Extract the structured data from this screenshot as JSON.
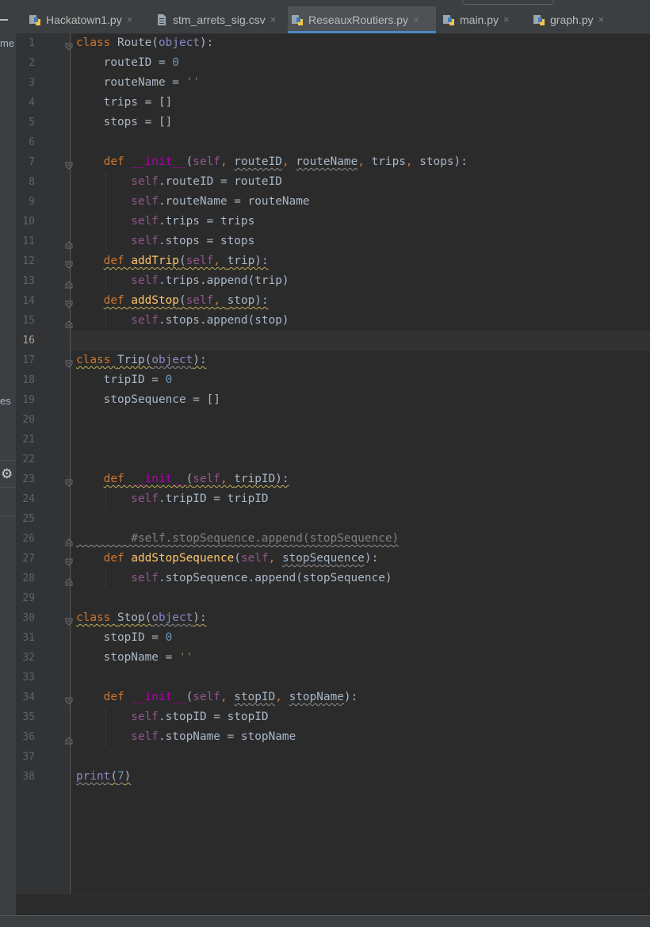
{
  "left_panel": {
    "clip_text_1": "me",
    "clip_text_2": "es"
  },
  "tabs": [
    {
      "label": "Hackatown1.py",
      "icon": "python-file-icon"
    },
    {
      "label": "stm_arrets_sig.csv",
      "icon": "text-file-icon"
    },
    {
      "label": "ReseauxRoutiers.py",
      "icon": "python-file-icon",
      "active": true
    },
    {
      "label": "main.py",
      "icon": "python-file-icon"
    },
    {
      "label": "graph.py",
      "icon": "python-file-icon"
    }
  ],
  "close_glyph": "×",
  "current_line": 16,
  "lines": [
    [
      [
        "k",
        "class "
      ],
      [
        "p",
        "Route("
      ],
      [
        "bi",
        "object"
      ],
      [
        "p",
        "):"
      ]
    ],
    [
      [
        "p",
        "    routeID = "
      ],
      [
        "n",
        "0"
      ]
    ],
    [
      [
        "p",
        "    routeName = "
      ],
      [
        "s",
        "''"
      ]
    ],
    [
      [
        "p",
        "    trips = []"
      ]
    ],
    [
      [
        "p",
        "    stops = []"
      ]
    ],
    [],
    [
      [
        "k",
        "    def "
      ],
      [
        "mg",
        "__init__"
      ],
      [
        "p",
        "("
      ],
      [
        "slf",
        "self"
      ],
      [
        "k",
        ", "
      ],
      [
        "wv",
        "routeID"
      ],
      [
        "k",
        ", "
      ],
      [
        "wv",
        "routeName"
      ],
      [
        "k",
        ", "
      ],
      [
        "p",
        "trips"
      ],
      [
        "k",
        ", "
      ],
      [
        "p",
        "stops):"
      ]
    ],
    [
      [
        "slf",
        "        self"
      ],
      [
        "p",
        ".routeID = routeID"
      ]
    ],
    [
      [
        "slf",
        "        self"
      ],
      [
        "p",
        ".routeName = routeName"
      ]
    ],
    [
      [
        "slf",
        "        self"
      ],
      [
        "p",
        ".trips = trips"
      ]
    ],
    [
      [
        "slf",
        "        self"
      ],
      [
        "p",
        ".stops = stops"
      ]
    ],
    [
      [
        "k",
        "    "
      ],
      [
        "wvk",
        "def "
      ],
      [
        "wvf",
        "addTrip"
      ],
      [
        "wvp",
        "("
      ],
      [
        "wvs",
        "self"
      ],
      [
        "wvk",
        ", "
      ],
      [
        "wvp",
        "trip):"
      ]
    ],
    [
      [
        "slf",
        "        self"
      ],
      [
        "p",
        ".trips.append(trip)"
      ]
    ],
    [
      [
        "k",
        "    "
      ],
      [
        "wvk",
        "def "
      ],
      [
        "wvf",
        "addStop"
      ],
      [
        "wvp",
        "("
      ],
      [
        "wvs",
        "self"
      ],
      [
        "wvk",
        ", "
      ],
      [
        "wvp",
        "stop):"
      ]
    ],
    [
      [
        "slf",
        "        self"
      ],
      [
        "p",
        ".stops.append(stop)"
      ]
    ],
    [],
    [
      [
        "wvk",
        "class "
      ],
      [
        "wvp",
        "Trip("
      ],
      [
        "wvb",
        "object"
      ],
      [
        "wvp",
        "):"
      ]
    ],
    [
      [
        "p",
        "    tripID = "
      ],
      [
        "n",
        "0"
      ]
    ],
    [
      [
        "p",
        "    stopSequence = []"
      ]
    ],
    [],
    [],
    [],
    [
      [
        "k",
        "    "
      ],
      [
        "wvk",
        "def "
      ],
      [
        "wvm",
        "__init__"
      ],
      [
        "wvp",
        "("
      ],
      [
        "wvs",
        "self"
      ],
      [
        "wvk",
        ", "
      ],
      [
        "wvp",
        "tripID):"
      ]
    ],
    [
      [
        "slf",
        "        self"
      ],
      [
        "p",
        ".tripID = tripID"
      ]
    ],
    [],
    [
      [
        "cmw",
        "        #self.stopSequence.append(stopSequence)"
      ]
    ],
    [
      [
        "k",
        "    def "
      ],
      [
        "fn",
        "addStopSequence"
      ],
      [
        "p",
        "("
      ],
      [
        "slf",
        "self"
      ],
      [
        "k",
        ", "
      ],
      [
        "wv",
        "stopSequence"
      ],
      [
        "p",
        "):"
      ]
    ],
    [
      [
        "slf",
        "        self"
      ],
      [
        "p",
        ".stopSequence.append(stopSequence)"
      ]
    ],
    [],
    [
      [
        "wvk",
        "class "
      ],
      [
        "wvp",
        "Stop("
      ],
      [
        "wvb",
        "object"
      ],
      [
        "wvp",
        "):"
      ]
    ],
    [
      [
        "p",
        "    stopID = "
      ],
      [
        "n",
        "0"
      ]
    ],
    [
      [
        "p",
        "    stopName = "
      ],
      [
        "s",
        "''"
      ]
    ],
    [],
    [
      [
        "k",
        "    def "
      ],
      [
        "mg",
        "__init__"
      ],
      [
        "p",
        "("
      ],
      [
        "slf",
        "self"
      ],
      [
        "k",
        ", "
      ],
      [
        "wv",
        "stopID"
      ],
      [
        "k",
        ", "
      ],
      [
        "wv",
        "stopName"
      ],
      [
        "p",
        "):"
      ]
    ],
    [
      [
        "slf",
        "        self"
      ],
      [
        "p",
        ".stopID = stopID"
      ]
    ],
    [
      [
        "slf",
        "        self"
      ],
      [
        "p",
        ".stopName = stopName"
      ]
    ],
    [],
    [
      [
        "wvb",
        "print"
      ],
      [
        "wvp",
        "("
      ],
      [
        "wvn",
        "7"
      ],
      [
        "wvp",
        ")"
      ]
    ]
  ],
  "line_numbers": [
    "1",
    "2",
    "3",
    "4",
    "5",
    "6",
    "7",
    "8",
    "9",
    "10",
    "11",
    "12",
    "13",
    "14",
    "15",
    "16",
    "17",
    "18",
    "19",
    "20",
    "21",
    "22",
    "23",
    "24",
    "25",
    "26",
    "27",
    "28",
    "29",
    "30",
    "31",
    "32",
    "33",
    "34",
    "35",
    "36",
    "37",
    "38"
  ],
  "fold_markers": [
    {
      "line": 1,
      "type": "open"
    },
    {
      "line": 7,
      "type": "open"
    },
    {
      "line": 11,
      "type": "close"
    },
    {
      "line": 12,
      "type": "open"
    },
    {
      "line": 13,
      "type": "close"
    },
    {
      "line": 14,
      "type": "open"
    },
    {
      "line": 15,
      "type": "close"
    },
    {
      "line": 17,
      "type": "open"
    },
    {
      "line": 23,
      "type": "open"
    },
    {
      "line": 26,
      "type": "close"
    },
    {
      "line": 27,
      "type": "open"
    },
    {
      "line": 28,
      "type": "close"
    },
    {
      "line": 30,
      "type": "open"
    },
    {
      "line": 34,
      "type": "open"
    },
    {
      "line": 36,
      "type": "close"
    }
  ],
  "colors": {
    "keyword": "#cc7832",
    "number": "#6897bb",
    "string": "#6a8759",
    "self": "#94558d",
    "builtin": "#8888c6",
    "function": "#ffc66d",
    "magic": "#b200b2",
    "comment": "#808080",
    "text": "#a9b7c6",
    "accent": "#4a88c7"
  }
}
